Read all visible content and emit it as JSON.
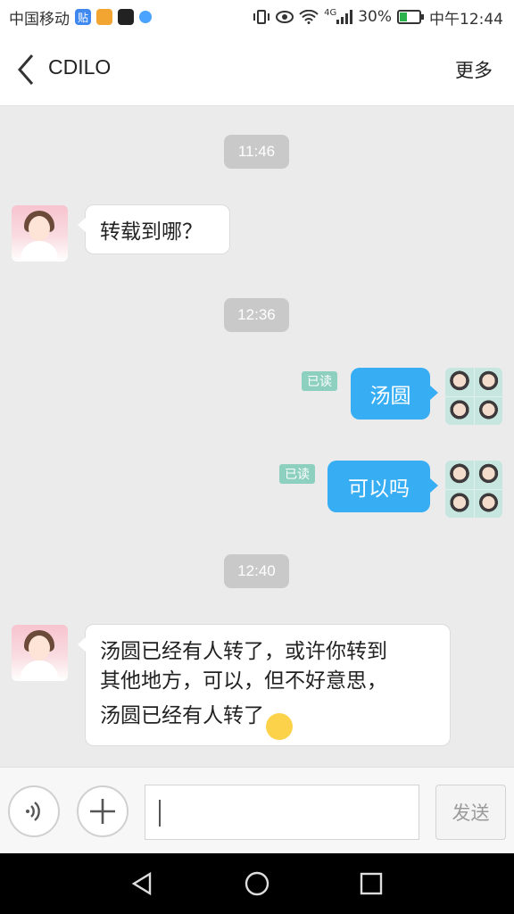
{
  "status_bar": {
    "carrier": "中国移动",
    "tieba_glyph": "贴",
    "battery": "30%",
    "clock": "中午12:44",
    "network": "4G"
  },
  "header": {
    "title": "CDILO",
    "more_label": "更多"
  },
  "messages": [
    {
      "type": "time",
      "text": "11:46"
    },
    {
      "type": "incoming",
      "text": "转载到哪？"
    },
    {
      "type": "time",
      "text": "12:36"
    },
    {
      "type": "outgoing",
      "text": "汤圆",
      "read": "已读"
    },
    {
      "type": "outgoing",
      "text": "可以吗",
      "read": "已读"
    },
    {
      "type": "time",
      "text": "12:40"
    },
    {
      "type": "incoming",
      "lines": [
        "汤圆已经有人转了，或许你转到",
        "其他地方，可以，但不好意思，",
        "汤圆已经有人转了"
      ],
      "emoji": "😯"
    }
  ],
  "input_bar": {
    "voice_icon": "voice-icon",
    "plus_icon": "plus-icon",
    "input_value": "",
    "send_label": "发送"
  },
  "colors": {
    "outgoing_bubble": "#37aef4",
    "read_badge": "#8ed0c0",
    "time_badge": "#c9c9c9",
    "chat_background": "#ebebeb"
  }
}
